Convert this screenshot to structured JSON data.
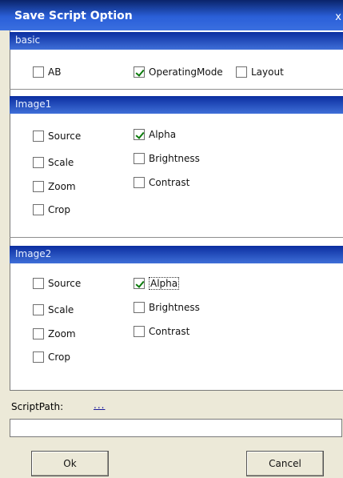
{
  "window": {
    "title": "Save Script Option",
    "close_glyph": "x"
  },
  "sections": {
    "basic": {
      "header": "basic",
      "options": [
        {
          "label": "AB",
          "checked": false
        },
        {
          "label": "OperatingMode",
          "checked": true
        },
        {
          "label": "Layout",
          "checked": false
        }
      ]
    },
    "image1": {
      "header": "Image1",
      "options": [
        {
          "label": "Source",
          "checked": false
        },
        {
          "label": "Scale",
          "checked": false
        },
        {
          "label": "Zoom",
          "checked": false
        },
        {
          "label": "Crop",
          "checked": false
        },
        {
          "label": "Alpha",
          "checked": true
        },
        {
          "label": "Brightness",
          "checked": false
        },
        {
          "label": "Contrast",
          "checked": false
        }
      ]
    },
    "image2": {
      "header": "Image2",
      "options": [
        {
          "label": "Source",
          "checked": false
        },
        {
          "label": "Scale",
          "checked": false
        },
        {
          "label": "Zoom",
          "checked": false
        },
        {
          "label": "Crop",
          "checked": false
        },
        {
          "label": "Alpha",
          "checked": true
        },
        {
          "label": "Brightness",
          "checked": false
        },
        {
          "label": "Contrast",
          "checked": false
        }
      ]
    }
  },
  "script_path": {
    "label": "ScriptPath:",
    "browse_label": "...",
    "value": "",
    "placeholder": ""
  },
  "buttons": {
    "ok_label": "Ok",
    "cancel_label": "Cancel"
  },
  "colors": {
    "header_blue": "#2a5fd8",
    "checkmark_green": "#0a7a0a"
  }
}
